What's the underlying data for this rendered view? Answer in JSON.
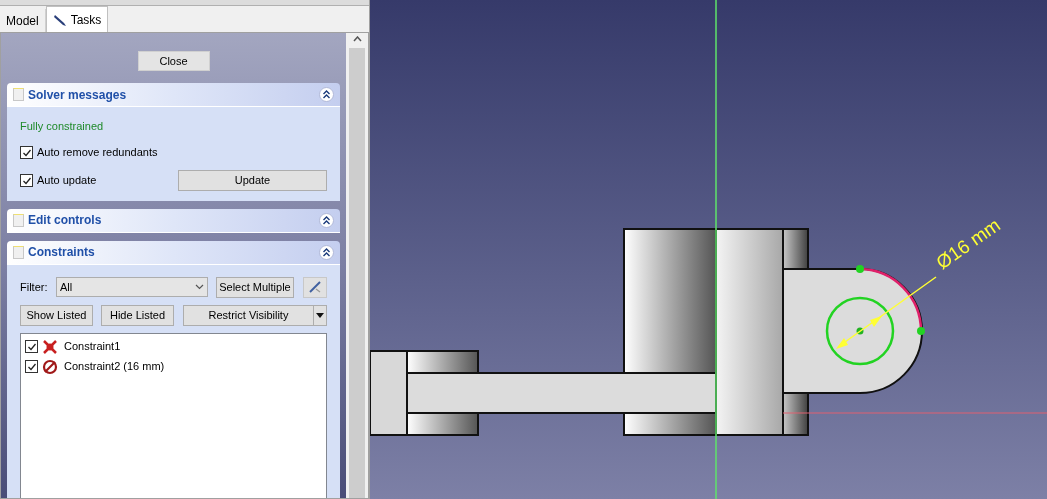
{
  "tabs": [
    {
      "label": "Model",
      "selected": false,
      "icon": false
    },
    {
      "label": "Tasks",
      "selected": true,
      "icon": true
    }
  ],
  "close_button": "Close",
  "solver_messages": {
    "title": "Solver messages",
    "status": "Fully constrained",
    "options": [
      {
        "label": "Auto remove redundants",
        "checked": true
      },
      {
        "label": "Auto update",
        "checked": true
      }
    ],
    "update_button": "Update"
  },
  "edit_controls": {
    "title": "Edit controls"
  },
  "constraints": {
    "title": "Constraints",
    "filter_label": "Filter:",
    "filter_value": "All",
    "select_multiple": "Select Multiple",
    "show_listed": "Show Listed",
    "hide_listed": "Hide Listed",
    "restrict_visibility": "Restrict Visibility",
    "items": [
      {
        "label": "Constraint1",
        "checked": true,
        "kind": "coincident"
      },
      {
        "label": "Constraint2 (16 mm)",
        "checked": true,
        "kind": "diameter"
      }
    ]
  },
  "viewport": {
    "dimension_label": "Ø16 mm"
  }
}
